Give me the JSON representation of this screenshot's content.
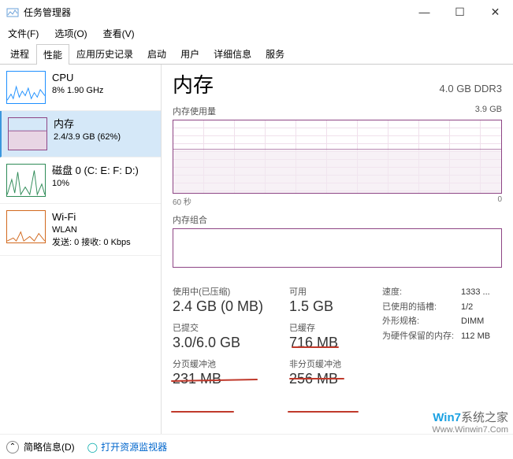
{
  "window": {
    "title": "任务管理器"
  },
  "menu": {
    "file": "文件(F)",
    "options": "选项(O)",
    "view": "查看(V)"
  },
  "tabs": [
    "进程",
    "性能",
    "应用历史记录",
    "启动",
    "用户",
    "详细信息",
    "服务"
  ],
  "active_tab_index": 1,
  "sidebar": [
    {
      "name": "CPU",
      "sub": "8% 1.90 GHz",
      "color": "#1e90ff"
    },
    {
      "name": "内存",
      "sub": "2.4/3.9 GB (62%)",
      "color": "#8e4585"
    },
    {
      "name": "磁盘 0 (C: E: F: D:)",
      "sub": "10%",
      "color": "#2e8b57"
    },
    {
      "name": "Wi-Fi",
      "sub": "WLAN",
      "sub2": "发送: 0 接收: 0 Kbps",
      "color": "#d2691e"
    }
  ],
  "selected_sidebar_index": 1,
  "main": {
    "title": "内存",
    "spec": "4.0 GB DDR3",
    "usage_label": "内存使用量",
    "usage_max": "3.9 GB",
    "axis_left": "60 秒",
    "axis_right": "0",
    "comp_label": "内存组合"
  },
  "stats_left": [
    {
      "label": "使用中(已压缩)",
      "value": "2.4 GB (0 MB)"
    },
    {
      "label": "已提交",
      "value": "3.0/6.0 GB"
    },
    {
      "label": "分页缓冲池",
      "value": "231 MB"
    }
  ],
  "stats_mid": [
    {
      "label": "可用",
      "value": "1.5 GB"
    },
    {
      "label": "已缓存",
      "value": "716 MB"
    },
    {
      "label": "非分页缓冲池",
      "value": "256 MB"
    }
  ],
  "stats_right": [
    {
      "label": "速度:",
      "value": "1333 ..."
    },
    {
      "label": "已使用的插槽:",
      "value": "1/2"
    },
    {
      "label": "外形规格:",
      "value": "DIMM"
    },
    {
      "label": "为硬件保留的内存:",
      "value": "112 MB"
    }
  ],
  "footer": {
    "brief": "简略信息(D)",
    "monitor": "打开资源监视器"
  },
  "watermark": {
    "brand_prefix": "Win7",
    "brand_suffix": "系统之家",
    "url": "Www.Winwin7.Com"
  },
  "chart_data": {
    "type": "area",
    "title": "内存使用量",
    "x_label_left": "60 秒",
    "x_label_right": "0",
    "ylim": [
      0,
      3.9
    ],
    "y_unit": "GB",
    "approx_current_usage": 2.4,
    "series": [
      {
        "name": "内存使用量",
        "values": [
          2.4,
          2.4,
          2.4,
          2.4,
          2.4,
          2.4,
          2.4,
          2.4,
          2.4,
          2.4,
          2.4,
          2.4
        ]
      }
    ]
  }
}
